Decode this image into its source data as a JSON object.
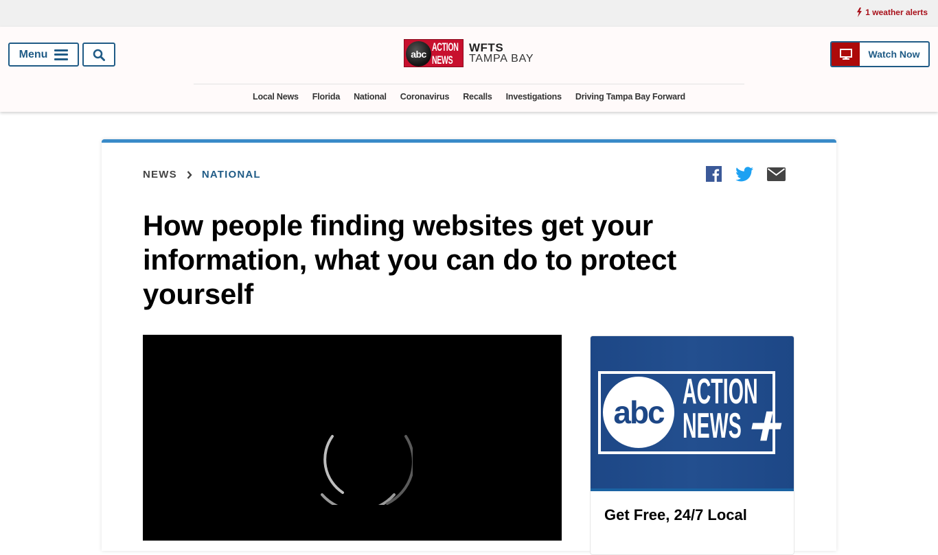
{
  "alert_bar": {
    "alert_text": "1 weather alerts",
    "alert_color": "#a8101a"
  },
  "header": {
    "menu_label": "Menu",
    "logo": {
      "badge_abc": "abc",
      "badge_action": "ACTION NEWS",
      "station": "WFTS",
      "market": "TAMPA BAY"
    },
    "watch_now_label": "Watch Now",
    "brand_color": "#1f5b86",
    "accent_red": "#ad0a0a"
  },
  "nav": {
    "items": [
      {
        "label": "Local News"
      },
      {
        "label": "Florida"
      },
      {
        "label": "National"
      },
      {
        "label": "Coronavirus"
      },
      {
        "label": "Recalls"
      },
      {
        "label": "Investigations"
      },
      {
        "label": "Driving Tampa Bay Forward"
      }
    ]
  },
  "article": {
    "breadcrumb": [
      "NEWS",
      "NATIONAL"
    ],
    "headline": "How people finding websites get your information, what you can do to protect yourself",
    "share": [
      "facebook",
      "twitter",
      "email"
    ],
    "video": {
      "state": "loading"
    }
  },
  "promo": {
    "logo_abc": "abc",
    "logo_text": "ACTION NEWS",
    "logo_plus": "+",
    "title": "Get Free, 24/7 Local"
  }
}
